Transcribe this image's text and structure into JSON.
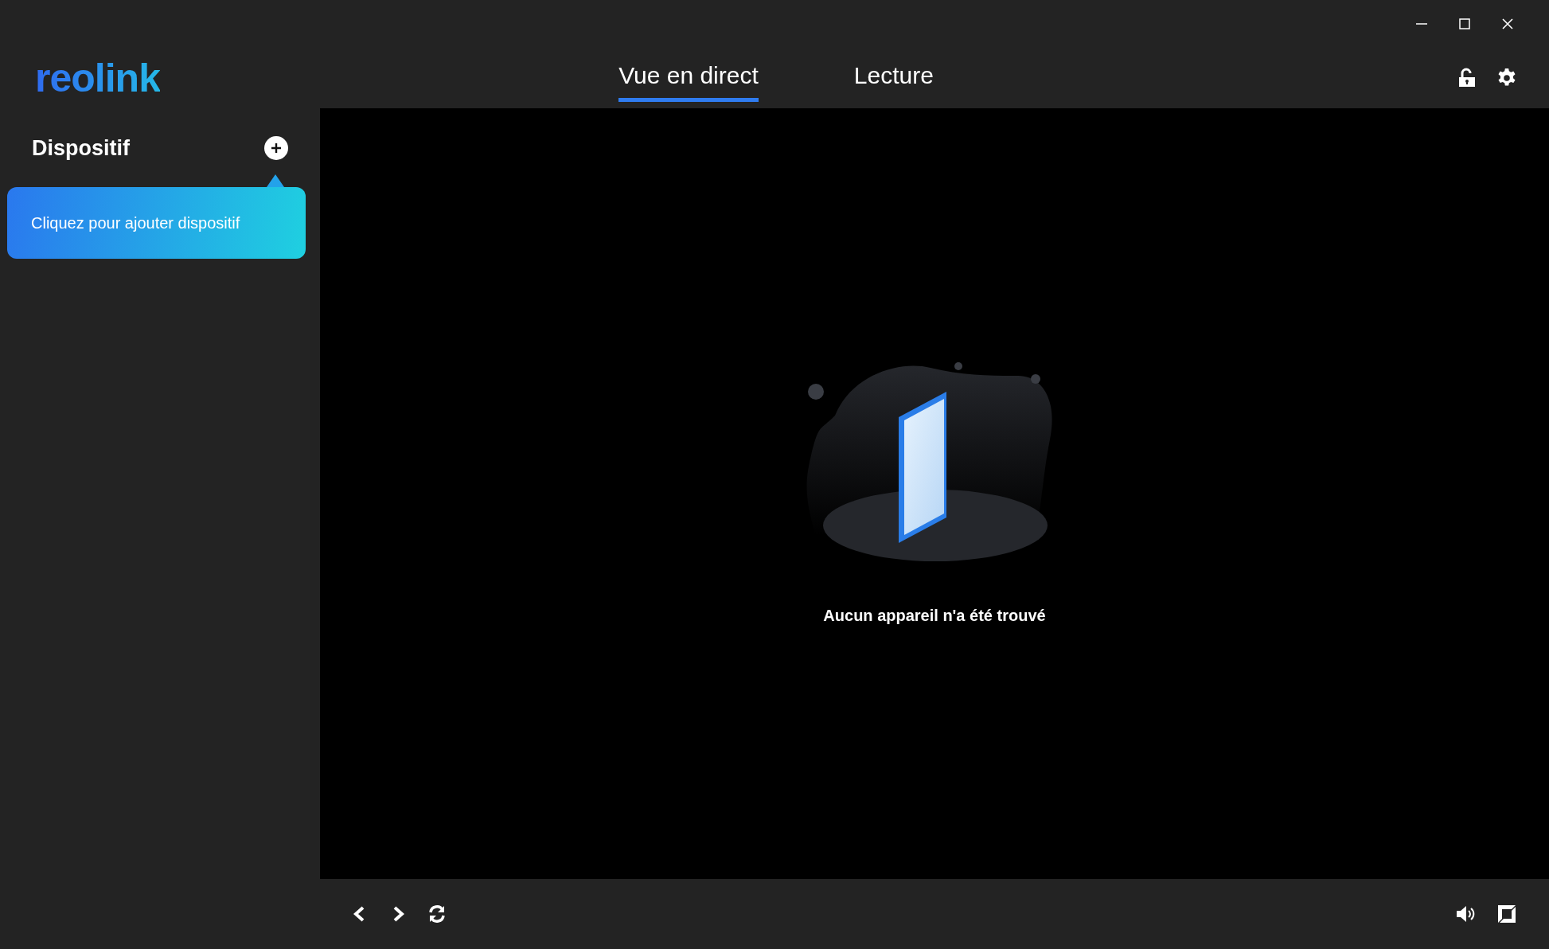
{
  "logo": "reolink",
  "tabs": [
    {
      "label": "Vue en direct",
      "selected": true
    },
    {
      "label": "Lecture",
      "selected": false
    }
  ],
  "sidebar": {
    "title": "Dispositif",
    "tooltip": "Cliquez pour ajouter dispositif"
  },
  "main": {
    "empty_message": "Aucun appareil n'a été trouvé"
  }
}
